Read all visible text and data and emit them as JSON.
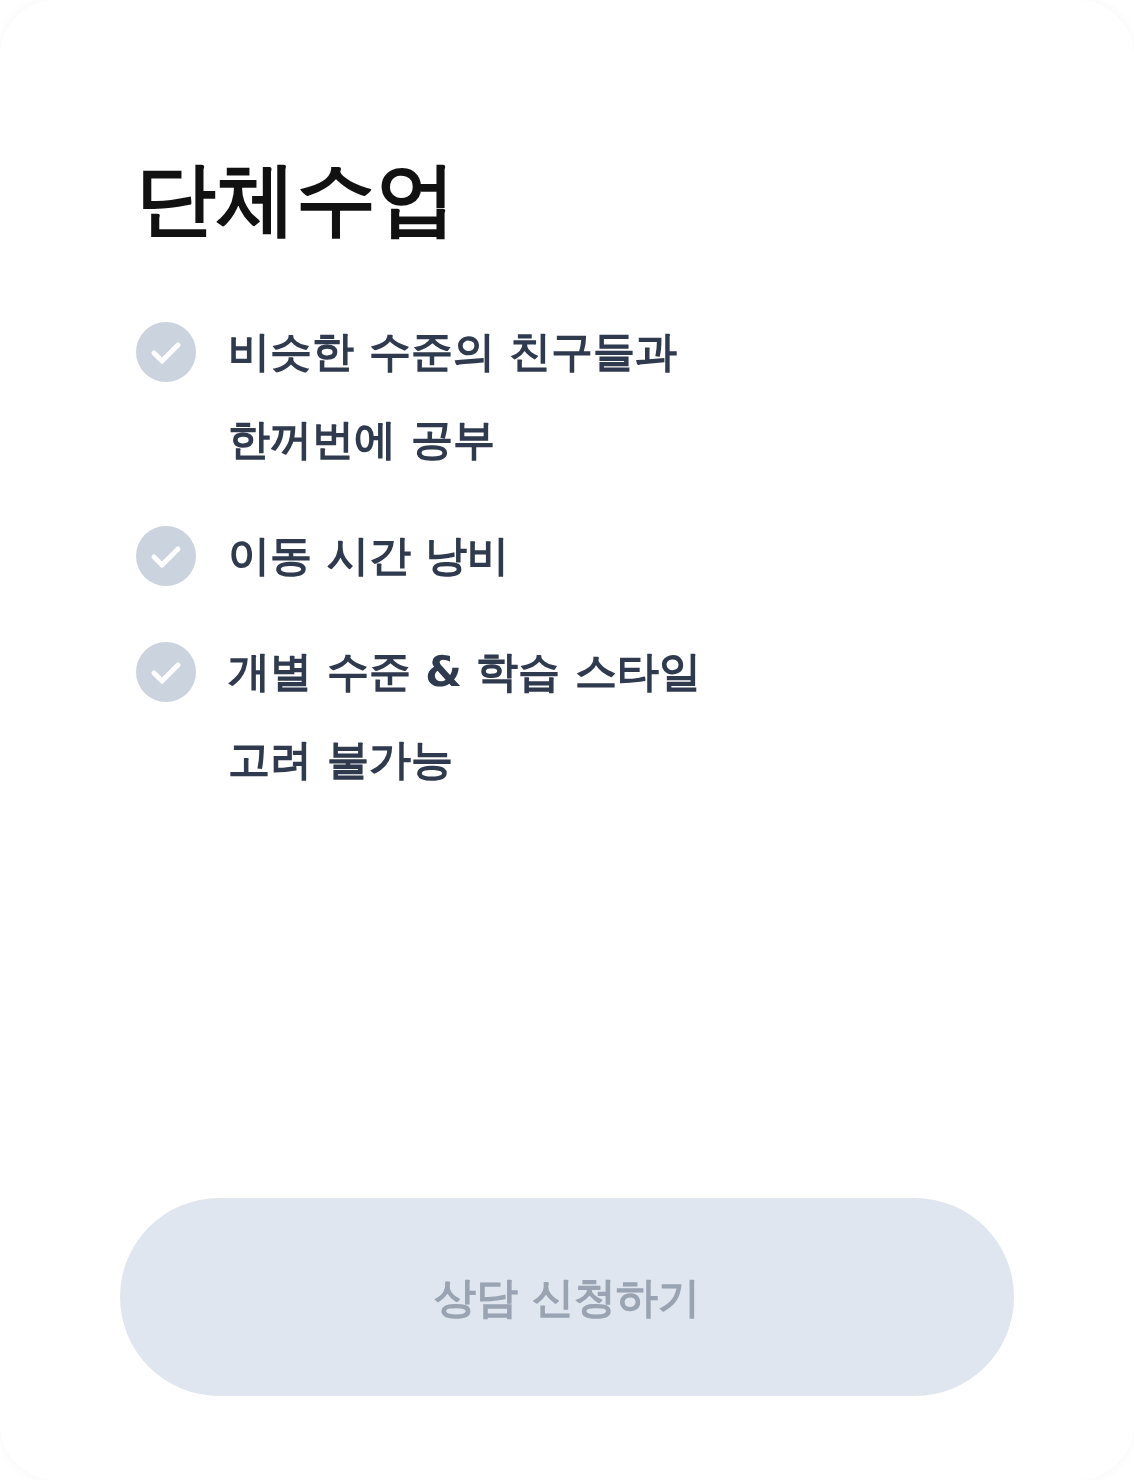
{
  "title": "단체수업",
  "features": [
    {
      "checked": true,
      "lines": [
        "비슷한 수준의 친구들과",
        "한꺼번에 공부"
      ]
    },
    {
      "checked": true,
      "lines": [
        "이동 시간 낭비"
      ]
    },
    {
      "checked": true,
      "lines": [
        "개별 수준 & 학습 스타일",
        "고려 불가능"
      ]
    }
  ],
  "button": {
    "label": "상담 신청하기",
    "disabled": true
  }
}
